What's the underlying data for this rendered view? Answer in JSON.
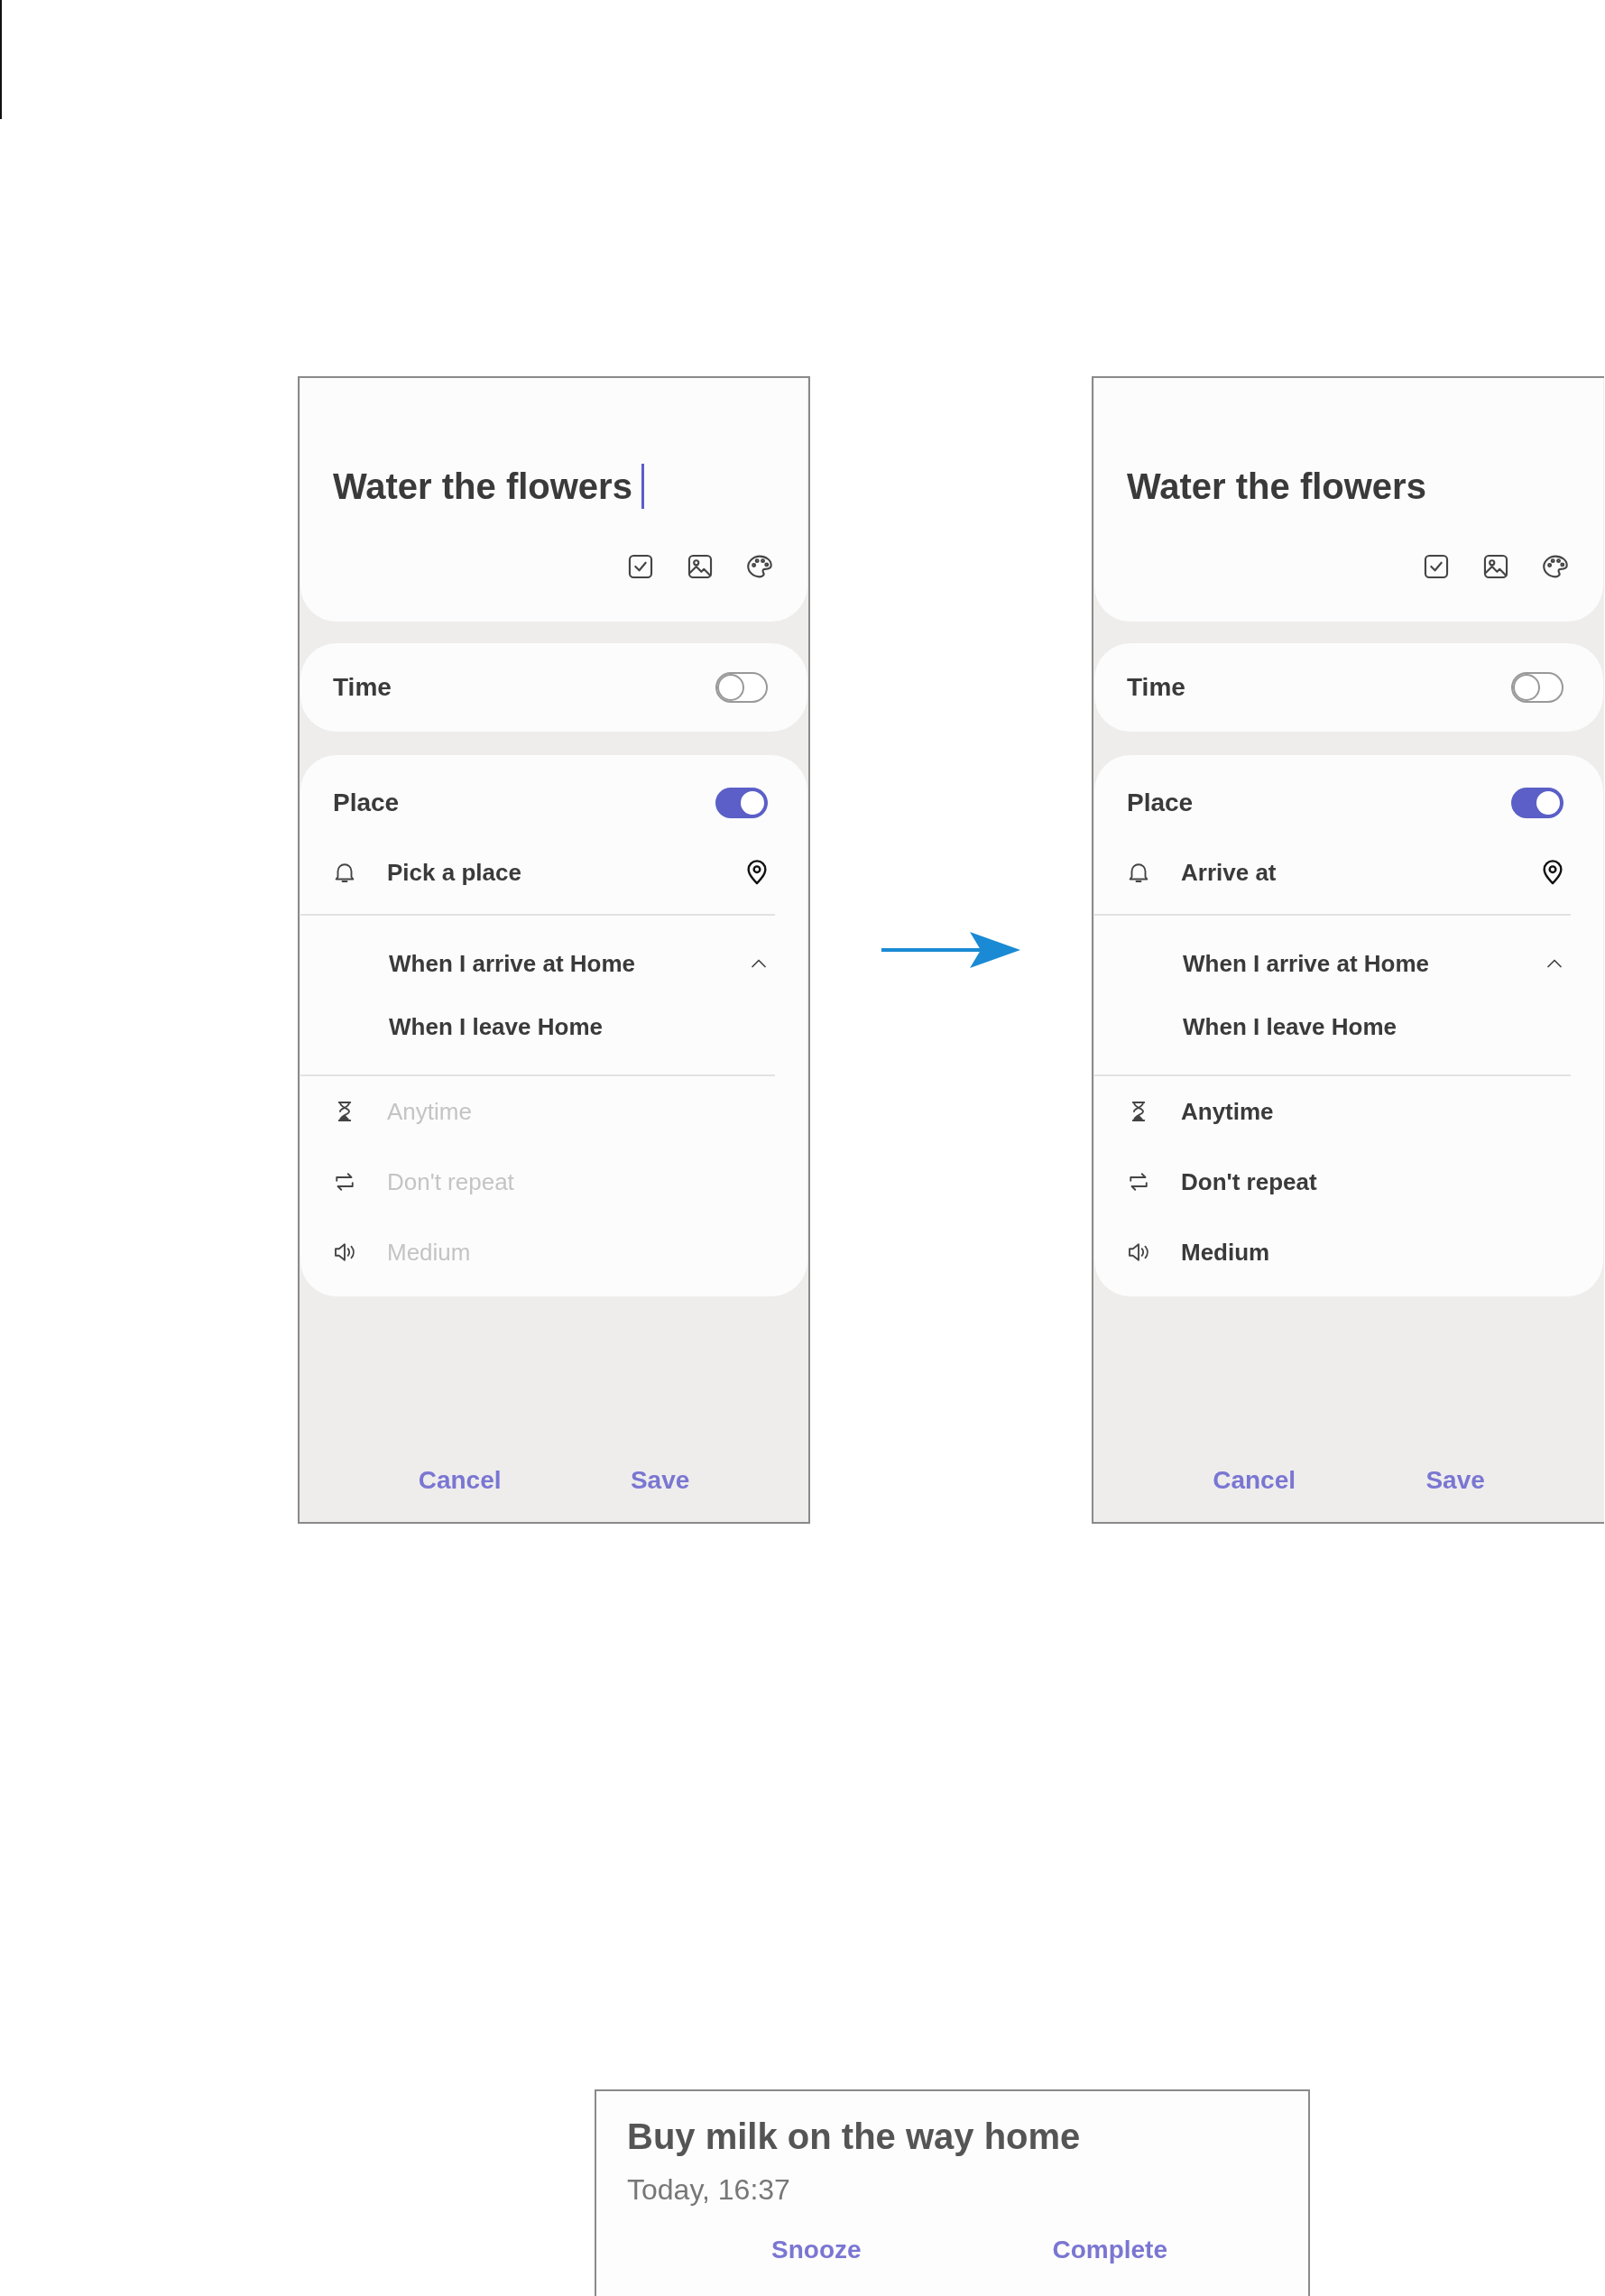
{
  "screens": [
    {
      "title": "Water the flowers",
      "cursor": true,
      "time": {
        "label": "Time",
        "on": false
      },
      "place": {
        "label": "Place",
        "on": true
      },
      "location": "Pick a place",
      "options_expanded": true,
      "options": [
        {
          "label": "When I arrive at Home"
        },
        {
          "label": "When I leave Home"
        }
      ],
      "settings": [
        {
          "kind": "duration",
          "label": "Anytime",
          "disabled": true
        },
        {
          "kind": "repeat",
          "label": "Don't repeat",
          "disabled": true
        },
        {
          "kind": "sound",
          "label": "Medium",
          "disabled": true
        }
      ],
      "buttons": [
        "Cancel",
        "Save"
      ]
    },
    {
      "title": "Water the flowers",
      "cursor": false,
      "time": {
        "label": "Time",
        "on": false
      },
      "place": {
        "label": "Place",
        "on": true
      },
      "location": "Arrive at",
      "options_expanded": true,
      "options": [
        {
          "label": "When I arrive at Home"
        },
        {
          "label": "When I leave Home"
        }
      ],
      "settings": [
        {
          "kind": "duration",
          "label": "Anytime",
          "disabled": false
        },
        {
          "kind": "repeat",
          "label": "Don't repeat",
          "disabled": false
        },
        {
          "kind": "sound",
          "label": "Medium",
          "disabled": false
        }
      ],
      "buttons": [
        "Cancel",
        "Save"
      ]
    }
  ],
  "notification": {
    "title": "Buy milk on the way home",
    "time": "Today, 16:37",
    "buttons": [
      "Snooze",
      "Complete"
    ]
  }
}
